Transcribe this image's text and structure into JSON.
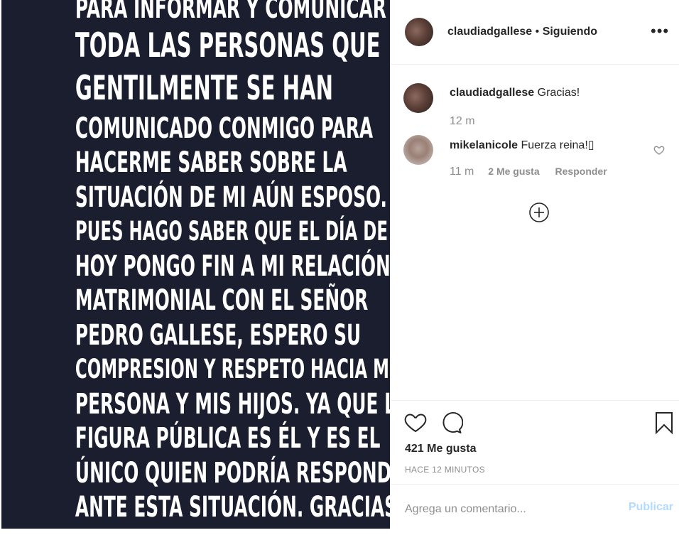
{
  "post_image": {
    "lines": [
      "PARA INFORMAR Y COMUNICAR A",
      "TODA LAS PERSONAS QUE",
      "GENTILMENTE SE HAN",
      "COMUNICADO CONMIGO PARA",
      "HACERME SABER SOBRE LA",
      "SITUACIÓN DE MI AÚN ESPOSO.",
      "PUES HAGO SABER QUE EL DÍA DE",
      "HOY PONGO FIN A MI RELACIÓN",
      "MATRIMONIAL CON EL SEÑOR",
      "PEDRO GALLESE, ESPERO SU",
      "COMPRESION Y RESPETO HACIA MI",
      "PERSONA Y MIS HIJOS. YA QUE LA",
      "FIGURA PÚBLICA ES ÉL Y ES EL",
      "ÚNICO QUIEN PODRÍA RESPONDER",
      "ANTE ESTA SITUACIÓN. GRACIAS!"
    ],
    "background": "#1b1e2e"
  },
  "header": {
    "username": "claudiadgallese",
    "separator": "•",
    "follow_status": "Siguiendo",
    "more_icon": "more-horizontal-icon"
  },
  "comments": [
    {
      "username": "claudiadgallese",
      "text": "Gracias!",
      "time": "12 m"
    },
    {
      "username": "mikelanicole",
      "text": "Fuerza reina!▯",
      "time": "11 m",
      "likes": "2 Me gusta",
      "reply": "Responder"
    }
  ],
  "load_more_icon": "plus-circle-icon",
  "actions": {
    "like_icon": "heart-icon",
    "comment_icon": "comment-icon",
    "save_icon": "bookmark-icon"
  },
  "likes_text": "421 Me gusta",
  "time_ago": "HACE 12 MINUTOS",
  "comment_box": {
    "placeholder": "Agrega un comentario...",
    "publish_label": "Publicar"
  },
  "colors": {
    "publish_disabled": "#b3dbff",
    "secondary_text": "#8e8e8e",
    "primary_text": "#262626"
  }
}
